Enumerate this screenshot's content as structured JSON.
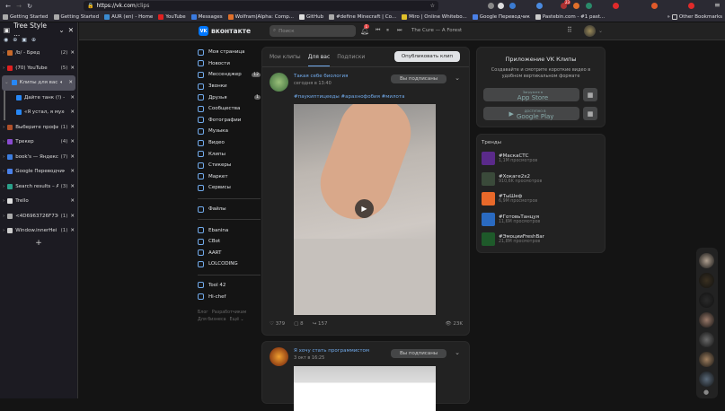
{
  "browser": {
    "url_host": "https://vk.com",
    "url_path": "/clips",
    "bookmarks": [
      "Getting Started",
      "Getting Started",
      "AUR (en) - Home",
      "YouTube",
      "Messages",
      "Wolfram|Alpha: Comp...",
      "GitHub",
      "#define Minecraft | Co...",
      "Miro | Online Whitebo...",
      "Google Переводчик",
      "Pastebin.com - #1 past..."
    ],
    "other_bookmarks": "Other Bookmarks",
    "ext_badge": "23"
  },
  "sidebar": {
    "title": "Tree Style ...",
    "tabs": [
      {
        "title": "/b/ - Бред",
        "count": "(2)",
        "color": "#c96a2a"
      },
      {
        "title": "(70) YouTube",
        "count": "(5)",
        "color": "#e02020"
      },
      {
        "title": "Клипы для вас",
        "count": "",
        "color": "#2787f5",
        "active": true
      },
      {
        "title": "Дайте танк (!) — У",
        "count": "",
        "color": "#2787f5",
        "child": true
      },
      {
        "title": "«Я устал, я мухом",
        "count": "",
        "color": "#2787f5",
        "child": true
      },
      {
        "title": "Выберите профи",
        "count": "(1)",
        "color": "#b0502a"
      },
      {
        "title": "Трекер",
        "count": "(4)",
        "color": "#8a4bd0"
      },
      {
        "title": "book's — Яндекс",
        "count": "(7)",
        "color": "#3b7de0"
      },
      {
        "title": "Google Переводчик",
        "count": "",
        "color": "#4a80e8"
      },
      {
        "title": "Search results – A",
        "count": "(3)",
        "color": "#2aa08a"
      },
      {
        "title": "Trello",
        "count": "",
        "color": "#ddd"
      },
      {
        "title": "<4D6963726F736",
        "count": "(1)",
        "color": "#aaa"
      },
      {
        "title": "Window.innerHei",
        "count": "(1)",
        "color": "#ccc"
      }
    ]
  },
  "vk": {
    "logo": "вконтакте",
    "logo_mark": "VK",
    "search_placeholder": "Поиск",
    "notif_count": "1",
    "track": "The Cure — A Forest",
    "nav": [
      {
        "label": "Моя страница"
      },
      {
        "label": "Новости"
      },
      {
        "label": "Мессенджер",
        "badge": "12"
      },
      {
        "label": "Звонки"
      },
      {
        "label": "Друзья",
        "badge": "1"
      },
      {
        "label": "Сообщества"
      },
      {
        "label": "Фотографии"
      },
      {
        "label": "Музыка"
      },
      {
        "label": "Видео"
      },
      {
        "label": "Клипы"
      },
      {
        "label": "Стикеры"
      },
      {
        "label": "Маркет"
      },
      {
        "label": "Сервисы"
      }
    ],
    "nav2": [
      "Файлы"
    ],
    "groups": [
      "Ebanina",
      "CBot",
      "AART",
      "LOLCODING"
    ],
    "apps": [
      "Tool 42",
      "Hi-chef"
    ],
    "footer": [
      "Блог",
      "Разработчикам",
      "Для бизнеса",
      "Ещё ⌄"
    ],
    "tabs": [
      "Мои клипы",
      "Для вас",
      "Подписки"
    ],
    "publish": "Опубликовать клип",
    "posts": [
      {
        "author": "Такая себе биология",
        "time": "сегодня в 13:40",
        "subscribed": "Вы подписаны",
        "tags": "#паукиптицееды #арахнофобия #милота",
        "likes": "379",
        "comments": "8",
        "shares": "157",
        "views": "23K"
      },
      {
        "author": "Я хочу стать программистом",
        "time": "3 окт в 16:25",
        "subscribed": "Вы подписаны"
      }
    ],
    "app_card": {
      "title": "Приложение VK Клипы",
      "desc": "Создавайте и смотрите короткие видео в удобном вертикальном формате",
      "appstore_small": "Загрузите в",
      "appstore": "App Store",
      "gplay_small": "ДОСТУПНО В",
      "gplay": "Google Play"
    },
    "trends": {
      "title": "Тренды",
      "items": [
        {
          "tag": "#МаскаСТС",
          "views": "1,1M просмотров",
          "color": "#5a2a8a"
        },
        {
          "tag": "#Хокаге2х2",
          "views": "910,6K просмотров",
          "color": "#3a4a3a"
        },
        {
          "tag": "#ТыШеф",
          "views": "6,9M просмотров",
          "color": "#e8692a"
        },
        {
          "tag": "#ГотовьТанцуя",
          "views": "11,6M просмотров",
          "color": "#2a6ac0"
        },
        {
          "tag": "#ЭмоцииFreshBar",
          "views": "21,8M просмотров",
          "color": "#1e5a2a"
        }
      ]
    }
  }
}
